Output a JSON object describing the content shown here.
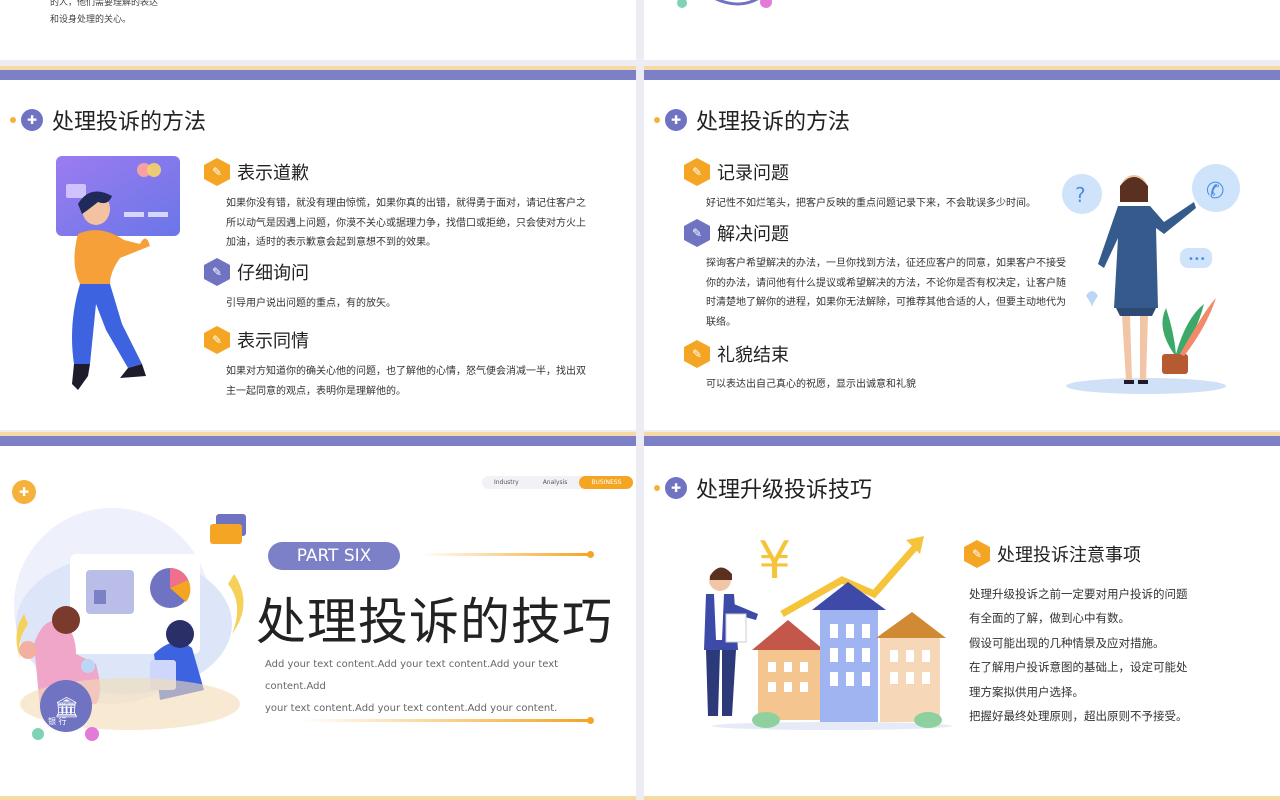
{
  "slide_tl": {
    "text_lines": [
      "的人，他们需要理解的表达",
      "和设身处理的关心。"
    ]
  },
  "slide_ml": {
    "title": "处理投诉的方法",
    "items": [
      {
        "title": "表示道歉",
        "body": "如果你没有错，就没有理由惊慌，如果你真的出错，就得勇于面对，请记住客户之所以动气是因遇上问题，你漠不关心或据理力争，找借口或拒绝，只会使对方火上加油，适时的表示歉意会起到意想不到的效果。"
      },
      {
        "title": "仔细询问",
        "body": "引导用户说出问题的重点，有的放矢。"
      },
      {
        "title": "表示同情",
        "body": "如果对方知道你的确关心他的问题，也了解他的心情，怒气便会消减一半，找出双主一起同意的观点，表明你是理解他的。"
      }
    ]
  },
  "slide_mr": {
    "title": "处理投诉的方法",
    "items": [
      {
        "title": "记录问题",
        "body": "好记性不如烂笔头，把客户反映的重点问题记录下来，不会耽误多少时间。"
      },
      {
        "title": "解决问题",
        "body": "探询客户希望解决的办法，一旦你找到方法，征还应客户的同意，如果客户不接受你的办法，请问他有什么提议或希望解决的方法，不论你是否有权决定，让客户随时清楚地了解你的进程，如果你无法解除，可推荐其他合适的人，但要主动地代为联络。"
      },
      {
        "title": "礼貌结束",
        "body": "可以表达出自己真心的祝愿，显示出诚意和礼貌"
      }
    ]
  },
  "slide_bl": {
    "tabs": [
      "Industry",
      "Analysis",
      "BUSINESS"
    ],
    "part_label": "PART SIX",
    "title": "处理投诉的技巧",
    "subtitle_lines": [
      "Add your text content.Add your text content.Add your text content.Add",
      "your text content.Add your text content.Add your content."
    ],
    "bank_label": "银 行",
    "accent": "#f4a523",
    "purple": "#7c80c6"
  },
  "slide_br": {
    "title": "处理升级投诉技巧",
    "item_title": "处理投诉注意事项",
    "lines": [
      "处理升级投诉之前一定要对用户投诉的问题",
      "有全面的了解，做到心中有数。",
      "假设可能出现的几种情景及应对措施。",
      "在了解用户投诉意图的基础上，设定可能处",
      "理方案拟供用户选择。",
      "把握好最终处理原则，超出原则不予接受。"
    ],
    "yen_symbol": "¥"
  },
  "icons": {
    "badge_icon": "pin-icon",
    "item_icon": "document-icon"
  }
}
